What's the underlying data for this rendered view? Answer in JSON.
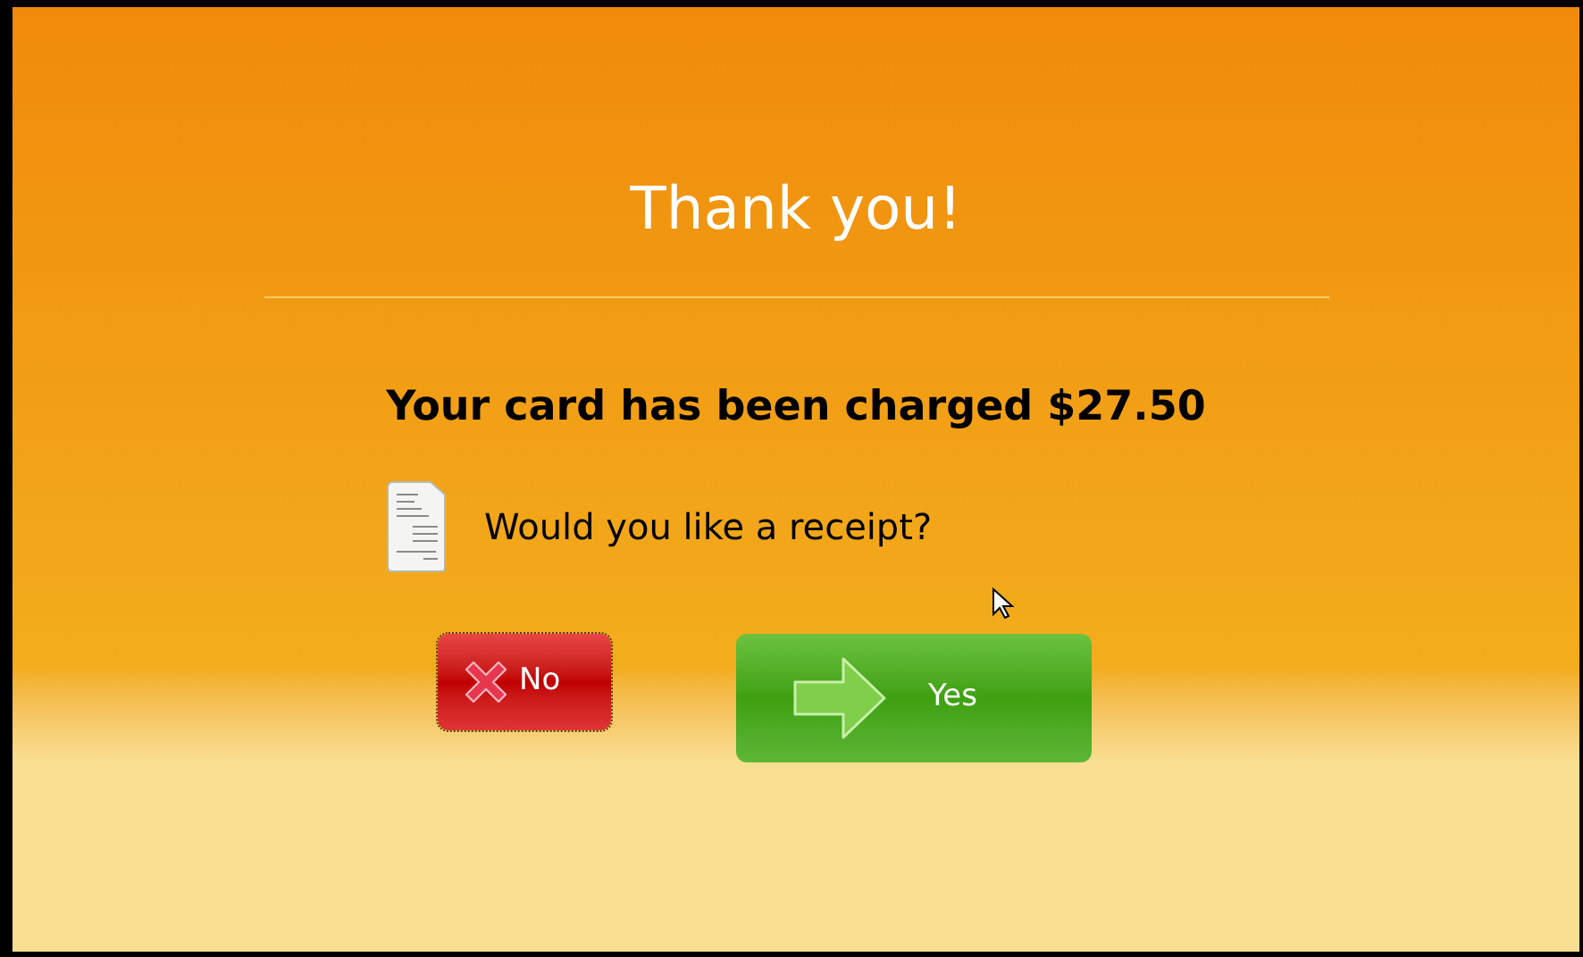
{
  "title": "Thank you!",
  "message": "Your card has been charged $27.50",
  "prompt": "Would you like a receipt?",
  "buttons": [
    {
      "kind": "decline",
      "label": "No",
      "focused": true
    },
    {
      "kind": "accept",
      "label": "Yes",
      "focused": false
    }
  ]
}
